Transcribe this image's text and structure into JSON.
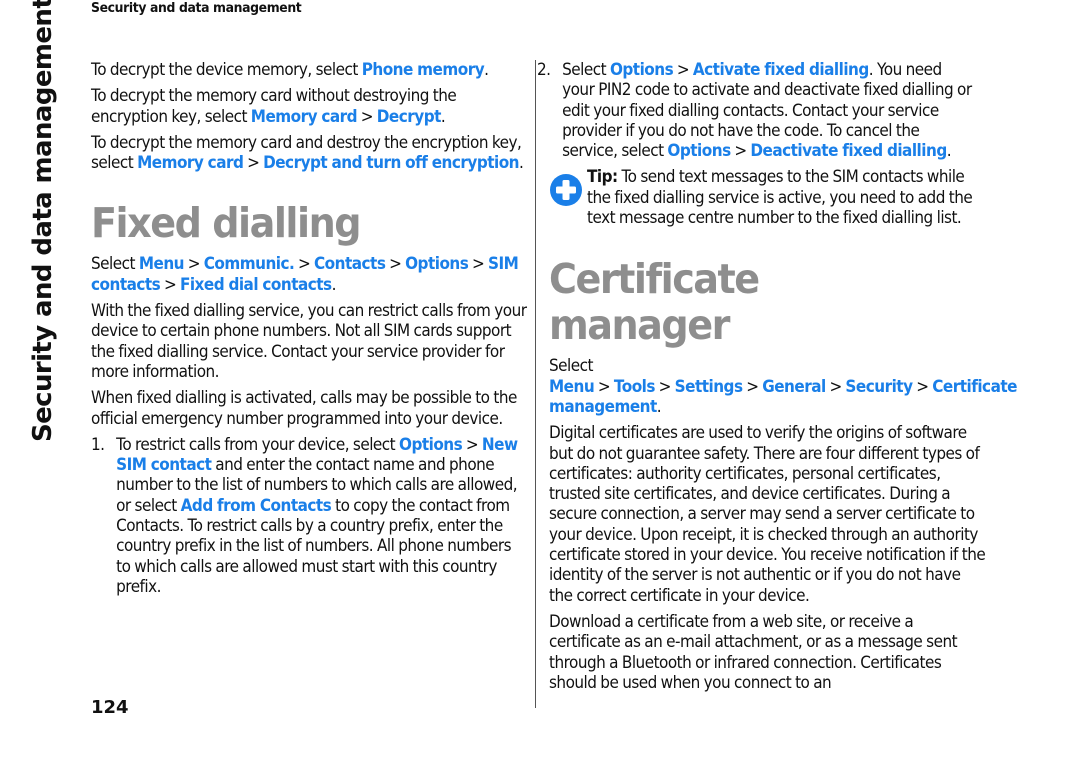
{
  "running_head": "Security and data management",
  "side_tab": "Security and data management",
  "page_number": "124",
  "colors": {
    "link": "#1a7fe8",
    "heading": "#8e8e8e",
    "tip_icon": "#1a7fe8"
  },
  "left_column": {
    "decrypt_phone": {
      "text": "To decrypt the device memory, select ",
      "link": "Phone memory",
      "end": "."
    },
    "decrypt_card_keep": {
      "text": "To decrypt the memory card without destroying the encryption key, select ",
      "path": [
        "Memory card",
        "Decrypt"
      ],
      "end": "."
    },
    "decrypt_card_destroy": {
      "text": "To decrypt the memory card and destroy the encryption key, select ",
      "path": [
        "Memory card",
        "Decrypt and turn off encryption"
      ],
      "end": "."
    },
    "fixed_dialling": {
      "title": "Fixed dialling",
      "select_label": "Select ",
      "path": [
        "Menu",
        "Communic.",
        "Contacts",
        "Options",
        "SIM contacts",
        "Fixed dial contacts"
      ],
      "para1": "With the fixed dialling service, you can restrict calls from your device to certain phone numbers. Not all SIM cards support the fixed dialling service. Contact your service provider for more information.",
      "para2": "When fixed dialling is activated, calls may be possible to the official emergency number programmed into your device.",
      "step1": {
        "num": "1.",
        "t1": "To restrict calls from your device, select ",
        "l1": "Options",
        "l2": "New SIM contact",
        "t2": " and enter the contact name and phone number to the list of numbers to which calls are allowed, or select ",
        "l3": "Add from Contacts",
        "t3": " to copy the contact from Contacts. To restrict calls by a country prefix, enter the country prefix in the list of numbers. All phone numbers to which calls are allowed must start with this country prefix."
      }
    }
  },
  "right_column": {
    "step2": {
      "num": "2.",
      "t1": "Select ",
      "l1": "Options",
      "l2": "Activate fixed dialling",
      "t2": ". You need your PIN2 code to activate and deactivate fixed dialling or edit your fixed dialling contacts. Contact your service provider if you do not have the code. To cancel the service, select ",
      "l3": "Options",
      "l4": "Deactivate fixed dialling",
      "end": "."
    },
    "tip": {
      "icon": "plus-circle-icon",
      "label": "Tip:",
      "text": " To send text messages to the SIM contacts while the fixed dialling service is active, you need to add the text message centre number to the fixed dialling list."
    },
    "certificate_manager": {
      "title": "Certificate manager",
      "select_label": "Select ",
      "path": [
        "Menu",
        "Tools",
        "Settings",
        "General",
        "Security",
        "Certificate management"
      ],
      "para1": "Digital certificates are used to verify the origins of software but do not guarantee safety. There are four different types of certificates: authority certificates, personal certificates, trusted site certificates, and device certificates. During a secure connection, a server may send a server certificate to your device. Upon receipt, it is checked through an authority certificate stored in your device. You receive notification if the identity of the server is not authentic or if you do not have the correct certificate in your device.",
      "para2": "Download a certificate from a web site, or receive a certificate as an e-mail attachment, or as a message sent through a Bluetooth or infrared connection. Certificates should be used when you connect to an"
    }
  },
  "separator": ">"
}
